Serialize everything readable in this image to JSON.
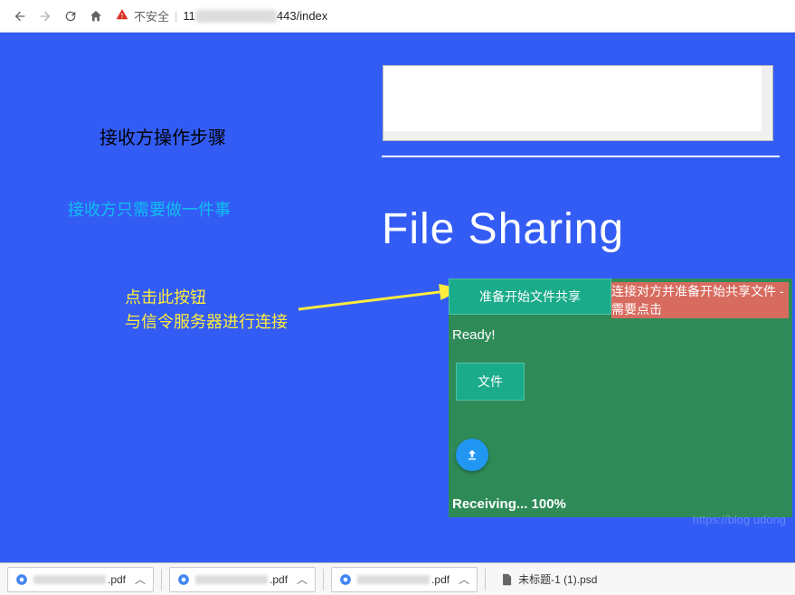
{
  "browser": {
    "insecure_label": "不安全",
    "url_prefix": "11",
    "url_suffix": "443/index"
  },
  "left": {
    "title": "接收方操作步骤",
    "subtitle": "接收方只需要做一件事",
    "instruction_line1": "点击此按钮",
    "instruction_line2": "与信令服务器进行连接"
  },
  "main": {
    "heading": "File Sharing",
    "prepare_button": "准备开始文件共享",
    "connect_button": "连接对方并准备开始共享文件 - 需要点击",
    "status": "Ready!",
    "file_button": "文件",
    "receiving": "Receiving... 100%"
  },
  "downloads": {
    "items": [
      {
        "ext": ".pdf"
      },
      {
        "ext": ".pdf"
      },
      {
        "ext": ".pdf"
      }
    ],
    "psd_label": "未标题-1 (1).psd"
  },
  "colors": {
    "page_bg": "#335cf5",
    "teal": "#1aab8a",
    "panel_green": "#2e8b57",
    "red": "#d86b5f",
    "yellow": "#ffec3d",
    "cyan": "#0fbfef"
  }
}
